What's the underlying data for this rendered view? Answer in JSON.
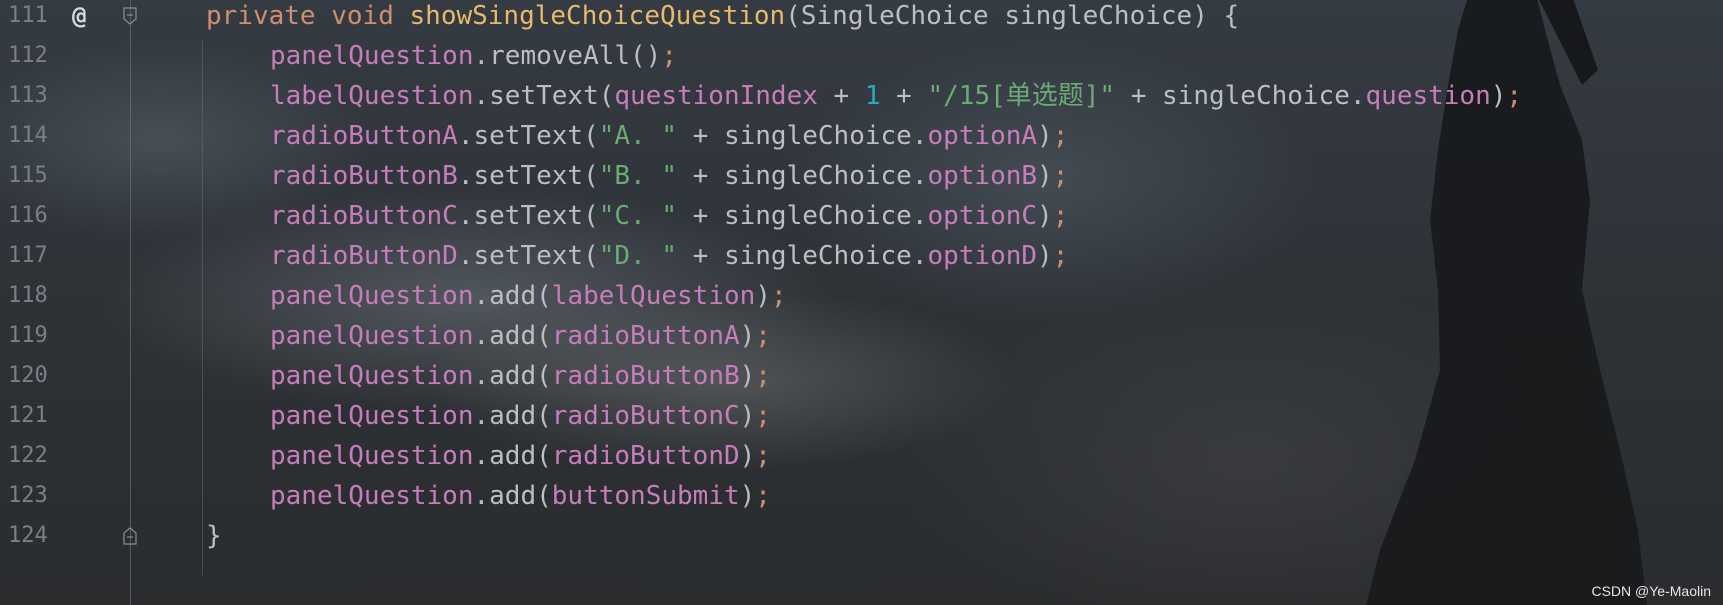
{
  "colors": {
    "keyword": "#cf8e6d",
    "method_declaration": "#e8b86b",
    "field": "#c77dbb",
    "string": "#6aab73",
    "number": "#2aacb8",
    "default_text": "#bcbec4",
    "line_number": "#7b8086"
  },
  "gutter": {
    "override_marker": "@",
    "fold_icon": "fold-icon"
  },
  "lines": [
    {
      "number": "111",
      "tokens": [
        "private",
        " ",
        "void",
        " ",
        "showSingleChoiceQuestion",
        "(SingleChoice singleChoice) {"
      ]
    },
    {
      "number": "112",
      "tokens": [
        "panelQuestion",
        ".removeAll()",
        ";"
      ]
    },
    {
      "number": "113",
      "tokens": [
        "labelQuestion",
        ".setText(",
        "questionIndex",
        " + ",
        "1",
        " + ",
        "\"/15[单选题]\"",
        " + singleChoice.",
        "question",
        ")",
        ";"
      ]
    },
    {
      "number": "114",
      "tokens": [
        "radioButtonA",
        ".setText(",
        "\"A. \"",
        " + singleChoice.",
        "optionA",
        ")",
        ";"
      ]
    },
    {
      "number": "115",
      "tokens": [
        "radioButtonB",
        ".setText(",
        "\"B. \"",
        " + singleChoice.",
        "optionB",
        ")",
        ";"
      ]
    },
    {
      "number": "116",
      "tokens": [
        "radioButtonC",
        ".setText(",
        "\"C. \"",
        " + singleChoice.",
        "optionC",
        ")",
        ";"
      ]
    },
    {
      "number": "117",
      "tokens": [
        "radioButtonD",
        ".setText(",
        "\"D. \"",
        " + singleChoice.",
        "optionD",
        ")",
        ";"
      ]
    },
    {
      "number": "118",
      "tokens": [
        "panelQuestion",
        ".add(",
        "labelQuestion",
        ")",
        ";"
      ]
    },
    {
      "number": "119",
      "tokens": [
        "panelQuestion",
        ".add(",
        "radioButtonA",
        ")",
        ";"
      ]
    },
    {
      "number": "120",
      "tokens": [
        "panelQuestion",
        ".add(",
        "radioButtonB",
        ")",
        ";"
      ]
    },
    {
      "number": "121",
      "tokens": [
        "panelQuestion",
        ".add(",
        "radioButtonC",
        ")",
        ";"
      ]
    },
    {
      "number": "122",
      "tokens": [
        "panelQuestion",
        ".add(",
        "radioButtonD",
        ")",
        ";"
      ]
    },
    {
      "number": "123",
      "tokens": [
        "panelQuestion",
        ".add(",
        "buttonSubmit",
        ")",
        ";"
      ]
    },
    {
      "number": "124",
      "tokens": [
        "}"
      ]
    }
  ],
  "watermark": "CSDN @Ye-Maolin"
}
